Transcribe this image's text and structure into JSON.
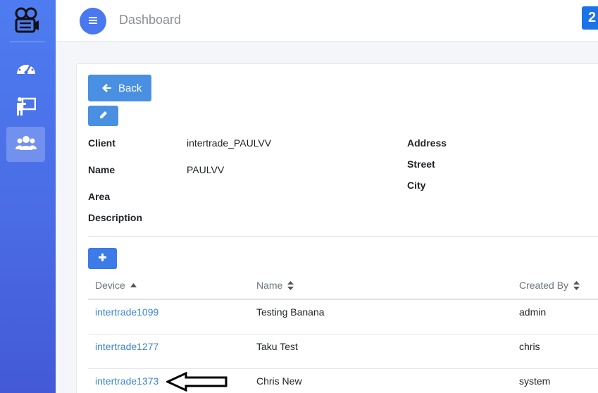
{
  "sidebar": {
    "logo_icon": "film-camera-icon",
    "items": [
      {
        "icon": "speedometer-icon",
        "active": false
      },
      {
        "icon": "teacher-board-icon",
        "active": false
      },
      {
        "icon": "users-icon",
        "active": true
      }
    ]
  },
  "topbar": {
    "title": "Dashboard",
    "badge": "2",
    "menu_icon": "hamburger-icon"
  },
  "detail": {
    "back_label": "Back",
    "fields": {
      "client_label": "Client",
      "client_value": "intertrade_PAULVV",
      "name_label": "Name",
      "name_value": "PAULVV",
      "area_label": "Area",
      "description_label": "Description",
      "address_label": "Address",
      "street_label": "Street",
      "city_label": "City"
    }
  },
  "table": {
    "columns": [
      "Device",
      "Name",
      "Created By"
    ],
    "rows": [
      {
        "device": "intertrade1099",
        "name": "Testing Banana",
        "created_by": "admin"
      },
      {
        "device": "intertrade1277",
        "name": "Taku Test",
        "created_by": "chris"
      },
      {
        "device": "intertrade1373",
        "name": "Chris New",
        "created_by": "system"
      }
    ]
  },
  "colors": {
    "sidebar": "#4a6ee6",
    "primary_button": "#4a90e2",
    "link": "#3d84d6",
    "badge": "#1a73e8"
  }
}
